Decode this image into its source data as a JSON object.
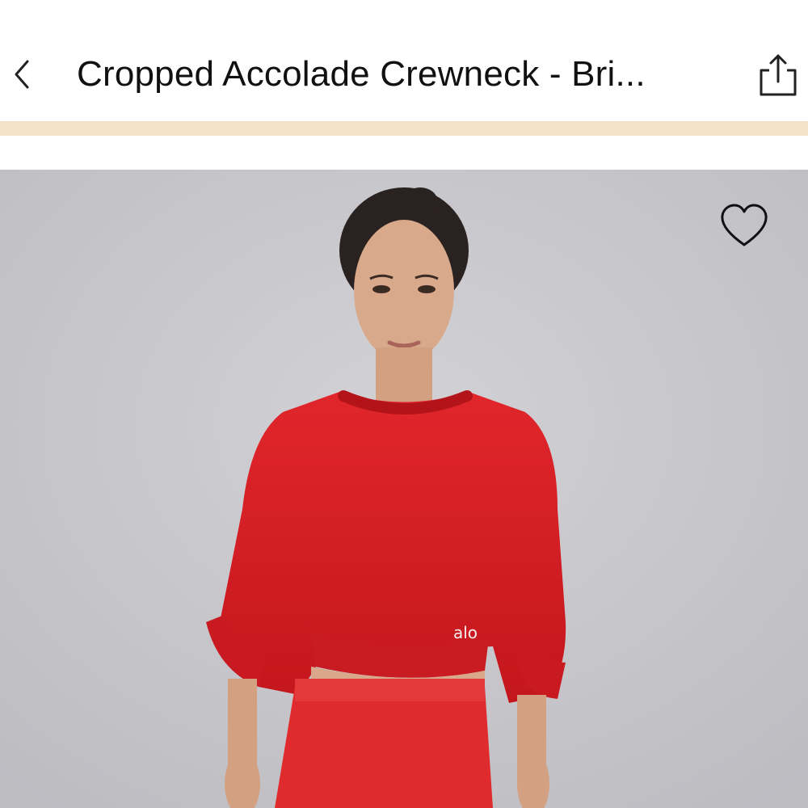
{
  "header": {
    "title": "Cropped Accolade Crewneck - Bri...",
    "back_icon": "chevron-left-icon",
    "share_icon": "share-icon"
  },
  "progress": {
    "color": "#f3e2c7"
  },
  "product_image": {
    "background_color": "#c8c8cc",
    "garment_color": "#d81f26",
    "favorite_icon": "heart-outline-icon",
    "brand_mark": "alo"
  }
}
